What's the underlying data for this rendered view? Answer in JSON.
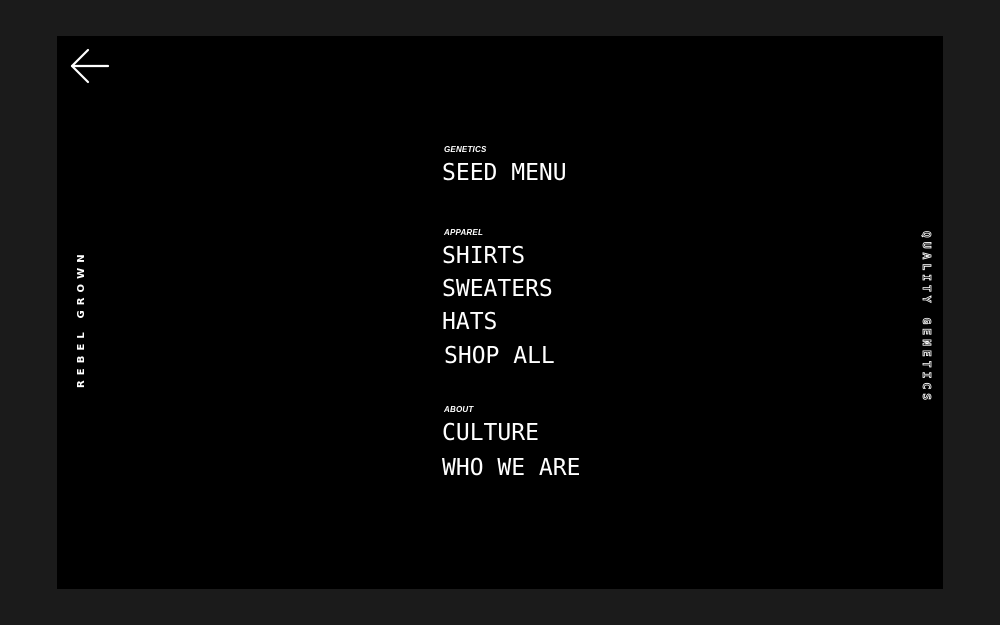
{
  "back": {
    "icon": "arrow-left-icon"
  },
  "side": {
    "left_text": "REBEL GROWN",
    "right_text": "QUALITY GENETICS"
  },
  "menu": {
    "genetics": {
      "label": "GENETICS",
      "items": [
        "SEED MENU"
      ]
    },
    "apparel": {
      "label": "APPAREL",
      "items": [
        "SHIRTS",
        "SWEATERS",
        "HATS",
        "SHOP ALL"
      ]
    },
    "about": {
      "label": "ABOUT",
      "items": [
        "CULTURE",
        "WHO WE ARE"
      ]
    }
  },
  "colors": {
    "background": "#1b1b1b",
    "panel": "#000000",
    "text": "#ffffff"
  }
}
